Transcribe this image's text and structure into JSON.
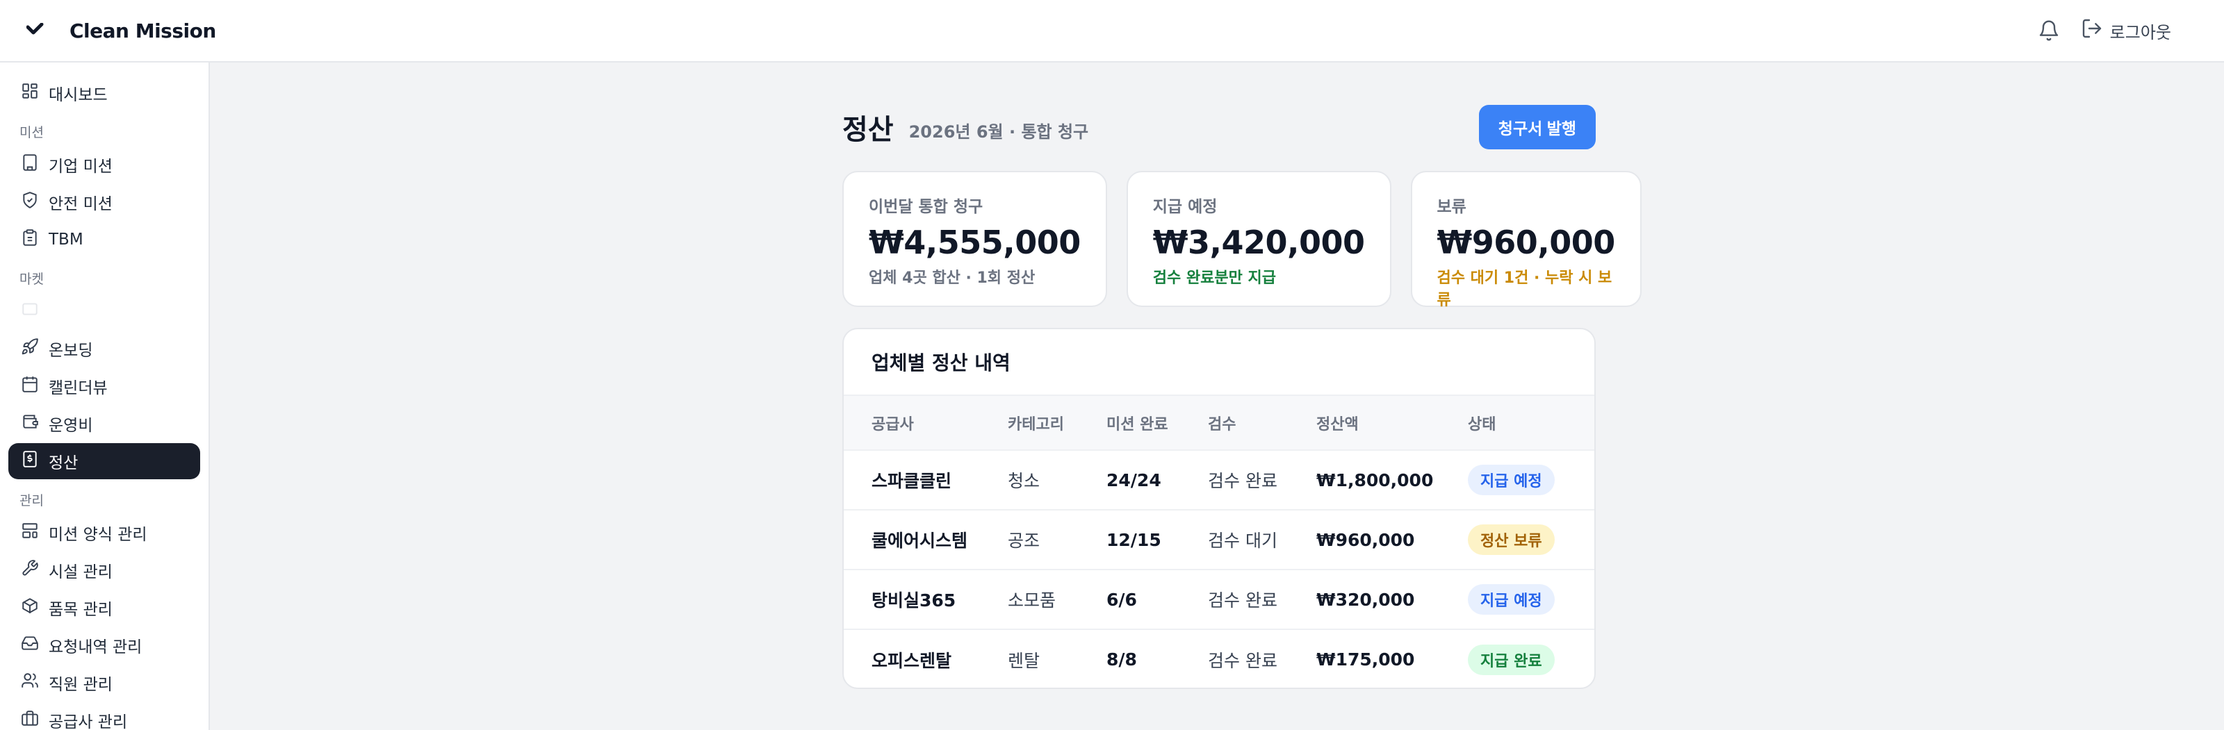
{
  "header": {
    "brand": "Clean Mission",
    "logout_label": "로그아웃"
  },
  "sidebar": {
    "dashboard": "대시보드",
    "sections": {
      "mission": "미션",
      "market": "마켓",
      "manage": "관리"
    },
    "mission_items": [
      {
        "label": "기업 미션",
        "icon": "building-icon"
      },
      {
        "label": "안전 미션",
        "icon": "shield-icon"
      },
      {
        "label": "TBM",
        "icon": "clipboard-icon"
      }
    ],
    "market_items": [
      {
        "label": "온보딩",
        "icon": "rocket-icon"
      },
      {
        "label": "캘린더뷰",
        "icon": "calendar-icon"
      },
      {
        "label": "운영비",
        "icon": "wallet-icon"
      },
      {
        "label": "정산",
        "icon": "receipt-icon",
        "active": true
      }
    ],
    "manage_items": [
      {
        "label": "미션 양식 관리",
        "icon": "layout-icon"
      },
      {
        "label": "시설 관리",
        "icon": "wrench-icon"
      },
      {
        "label": "품목 관리",
        "icon": "box-icon"
      },
      {
        "label": "요청내역 관리",
        "icon": "inbox-icon"
      },
      {
        "label": "직원 관리",
        "icon": "users-icon"
      },
      {
        "label": "공급사 관리",
        "icon": "briefcase-icon"
      }
    ]
  },
  "page": {
    "title": "정산",
    "subtitle": "2026년 6월 · 통합 청구",
    "issue_button": "청구서 발행"
  },
  "cards": [
    {
      "label": "이번달 통합 청구",
      "value": "₩4,555,000",
      "note": "업체 4곳 합산 · 1회 정산",
      "note_color": "#6b7280"
    },
    {
      "label": "지급 예정",
      "value": "₩3,420,000",
      "note": "검수 완료분만 지급",
      "note_color": "#15803d"
    },
    {
      "label": "보류",
      "value": "₩960,000",
      "note": "검수 대기 1건 · 누락 시 보류",
      "note_color": "#ca8a04"
    }
  ],
  "table": {
    "title": "업체별 정산 내역",
    "headers": [
      "공급사",
      "카테고리",
      "미션 완료",
      "검수",
      "정산액",
      "상태"
    ],
    "rows": [
      {
        "vendor": "스파클클린",
        "category": "청소",
        "completed": "24/24",
        "inspection": "검수 완료",
        "amount": "₩1,800,000",
        "status": "지급 예정",
        "status_bg": "#e8f0fe",
        "status_fg": "#2563eb"
      },
      {
        "vendor": "쿨에어시스템",
        "category": "공조",
        "completed": "12/15",
        "inspection": "검수 대기",
        "amount": "₩960,000",
        "status": "정산 보류",
        "status_bg": "#fdf3c7",
        "status_fg": "#a16207"
      },
      {
        "vendor": "탕비실365",
        "category": "소모품",
        "completed": "6/6",
        "inspection": "검수 완료",
        "amount": "₩320,000",
        "status": "지급 예정",
        "status_bg": "#e8f0fe",
        "status_fg": "#2563eb"
      },
      {
        "vendor": "오피스렌탈",
        "category": "렌탈",
        "completed": "8/8",
        "inspection": "검수 완료",
        "amount": "₩175,000",
        "status": "지급 완료",
        "status_bg": "#dcfce7",
        "status_fg": "#15803d"
      }
    ]
  }
}
